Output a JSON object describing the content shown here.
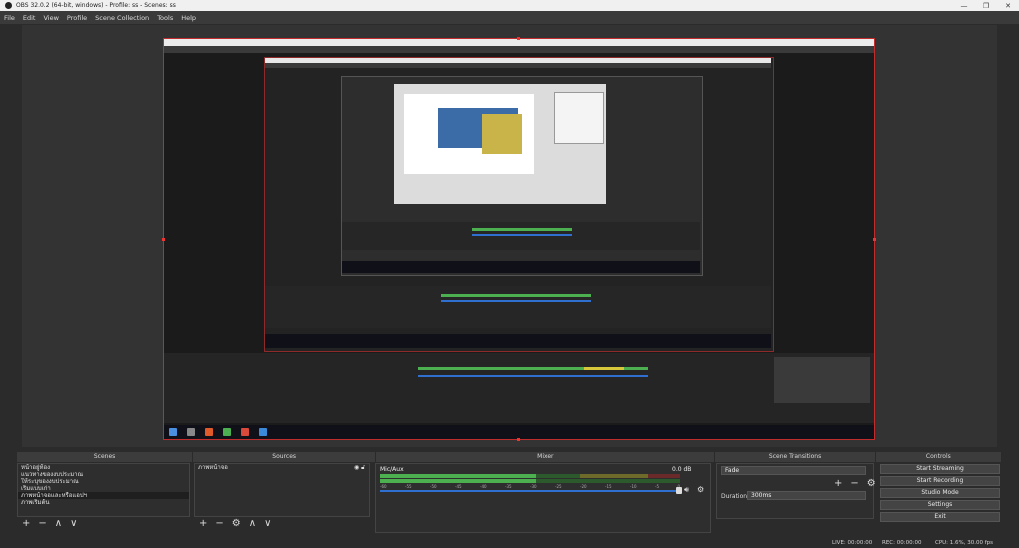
{
  "window": {
    "title": "OBS 32.0.2 (64-bit, windows) - Profile: ss - Scenes: ss",
    "minimize_icon": "minimize-icon",
    "maximize_icon": "maximize-icon",
    "close_icon": "close-icon"
  },
  "menu": [
    "File",
    "Edit",
    "View",
    "Profile",
    "Scene Collection",
    "Tools",
    "Help"
  ],
  "docks": {
    "scenes": "Scenes",
    "sources": "Sources",
    "mixer": "Mixer",
    "transitions": "Scene Transitions",
    "controls": "Controls"
  },
  "scenes": {
    "items": [
      "หน้าอยู่ท้อง",
      "แนวทางของงบประมาณ",
      "ให้ระบุของงบประมาณ",
      "เริ่มแบบเก่า",
      "ภาพหน้าจอและหรือแอปฯ",
      "ภาพเริ่มต้น"
    ],
    "selected_index": 4
  },
  "sources": {
    "items": [
      "ภาพหน้าจอ"
    ],
    "eye_icon": "eye-icon",
    "lock_icon": "lock-icon"
  },
  "mixer": {
    "track_name": "Mic/Aux",
    "db_value": "0.0 dB",
    "level_fraction": 0.52,
    "ticks": [
      "-60",
      "-55",
      "-50",
      "-45",
      "-40",
      "-35",
      "-30",
      "-25",
      "-20",
      "-15",
      "-10",
      "-5",
      "0"
    ]
  },
  "transitions": {
    "type": "Fade",
    "duration_label": "Duration",
    "duration_value": "300ms"
  },
  "controls": {
    "buttons": [
      "Start Streaming",
      "Start Recording",
      "Studio Mode",
      "Settings",
      "Exit"
    ]
  },
  "status": {
    "live": "LIVE: 00:00:00",
    "rec": "REC: 00:00:00",
    "cpu": "CPU: 1.6%, 30.00 fps"
  },
  "colors": {
    "preview_border": "#c12d2d",
    "meter_green": "#4caf50",
    "meter_yellow": "#d6c83a",
    "meter_red": "#c0392b",
    "volume_blue": "#2f6fd0"
  }
}
